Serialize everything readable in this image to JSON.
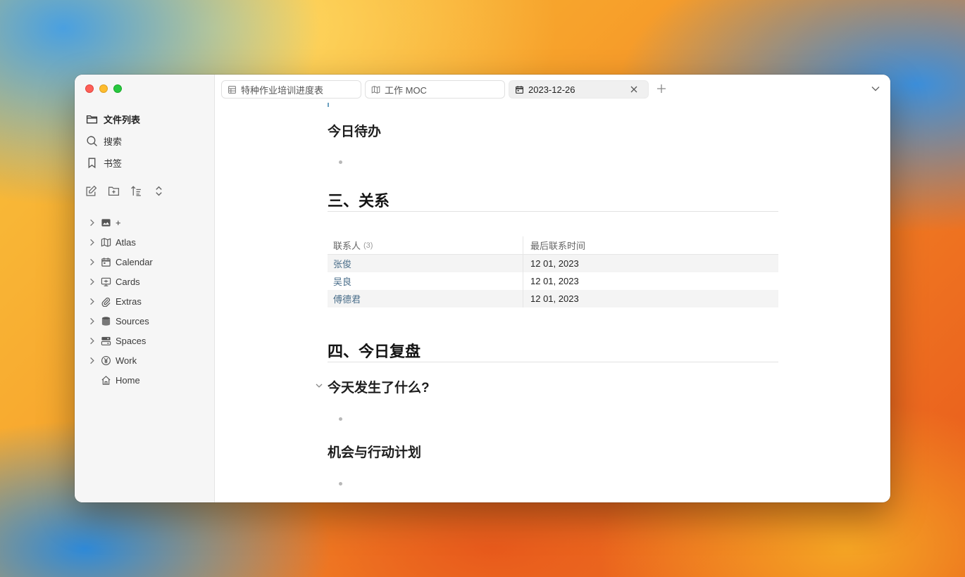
{
  "sidebar": {
    "nav": [
      {
        "label": "文件列表",
        "icon": "folder-icon"
      },
      {
        "label": "搜索",
        "icon": "search-icon"
      },
      {
        "label": "书签",
        "icon": "bookmark-icon"
      }
    ],
    "actions": [
      "new-note-icon",
      "new-folder-icon",
      "sort-icon",
      "collapse-icon"
    ],
    "tree": [
      {
        "label": "+",
        "icon": "image-icon"
      },
      {
        "label": "Atlas",
        "icon": "map-icon"
      },
      {
        "label": "Calendar",
        "icon": "calendar-icon"
      },
      {
        "label": "Cards",
        "icon": "card-icon"
      },
      {
        "label": "Extras",
        "icon": "paperclip-icon"
      },
      {
        "label": "Sources",
        "icon": "database-icon"
      },
      {
        "label": "Spaces",
        "icon": "spaces-icon"
      },
      {
        "label": "Work",
        "icon": "yen-icon"
      },
      {
        "label": "Home",
        "icon": "home-icon"
      }
    ]
  },
  "tabs": [
    {
      "label": "特种作业培训进度表",
      "icon": "table-icon"
    },
    {
      "label": "工作 MOC",
      "icon": "map-icon"
    },
    {
      "label": "2023-12-26",
      "icon": "calendar-icon"
    }
  ],
  "doc": {
    "todo_heading": "今日待办",
    "relations_heading": "三、关系",
    "table": {
      "headers": [
        "联系人",
        "最后联系时间"
      ],
      "count": "(3)",
      "rows": [
        {
          "name": "张俊",
          "date": "12 01, 2023"
        },
        {
          "name": "吴良",
          "date": "12 01, 2023"
        },
        {
          "name": "傅德君",
          "date": "12 01, 2023"
        }
      ]
    },
    "review_heading": "四、今日复盘",
    "what_happened_heading": "今天发生了什么?",
    "plan_heading": "机会与行动计划"
  }
}
